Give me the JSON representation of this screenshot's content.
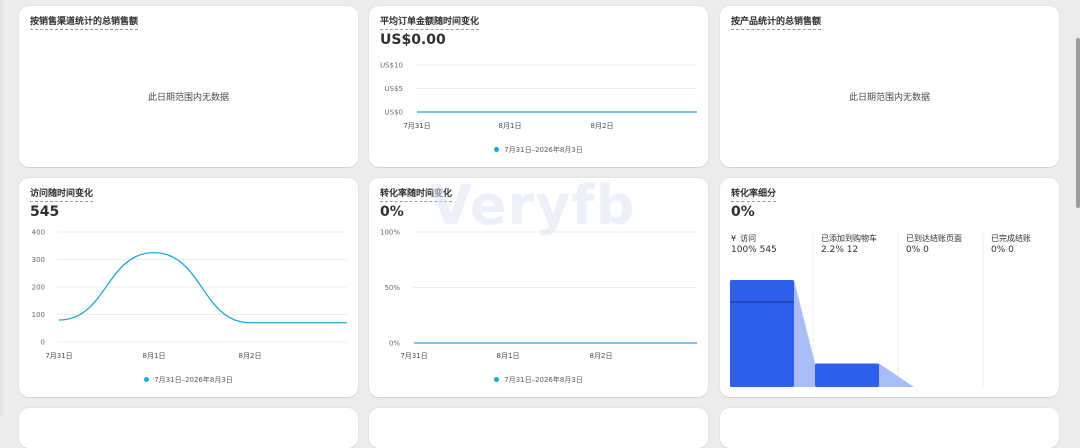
{
  "cards": {
    "sales_by_channel": {
      "title": "按销售渠道统计的总销售额",
      "empty": "此日期范围内无数据"
    },
    "aov": {
      "title": "平均订单金额随时间变化",
      "value": "US$0.00",
      "legend": "7月31日–2026年8月3日"
    },
    "sales_by_product": {
      "title": "按产品统计的总销售额",
      "empty": "此日期范围内无数据"
    },
    "sessions": {
      "title": "访问随时间变化",
      "value": "545",
      "legend": "7月31日–2026年8月3日"
    },
    "conversion": {
      "title": "转化率随时间变化",
      "value": "0%",
      "legend": "7月31日–2026年8月3日"
    },
    "funnel": {
      "title": "转化率细分",
      "value": "0%",
      "visits_icon": "¥",
      "steps": [
        {
          "label": "访问",
          "stat": "100% 545"
        },
        {
          "label": "已添加到购物车",
          "stat": "2.2% 12"
        },
        {
          "label": "已到达结账页面",
          "stat": "0% 0"
        },
        {
          "label": "已完成结账",
          "stat": "0% 0"
        }
      ]
    }
  },
  "watermark": "Veryfb",
  "chart_data": [
    {
      "type": "line",
      "categories": [
        "7月31日",
        "8月1日",
        "8月2日"
      ],
      "yticks": [
        "US$0",
        "US$5",
        "US$10"
      ],
      "ylim": [
        0,
        10
      ],
      "series": [
        {
          "name": "7月31日–2026年8月3日",
          "values": [
            0,
            0,
            0,
            0
          ]
        }
      ],
      "color": "#1ea7d6",
      "grid": true
    },
    {
      "type": "line",
      "categories": [
        "7月31日",
        "8月1日",
        "8月2日"
      ],
      "yticks": [
        "0",
        "100",
        "200",
        "300",
        "400"
      ],
      "ylim": [
        0,
        400
      ],
      "series": [
        {
          "name": "7月31日–2026年8月3日",
          "values": [
            80,
            325,
            70,
            70
          ]
        }
      ],
      "color": "#1ea7d6",
      "grid": true
    },
    {
      "type": "line",
      "categories": [
        "7月31日",
        "8月1日",
        "8月2日"
      ],
      "yticks": [
        "0%",
        "50%",
        "100%"
      ],
      "ylim": [
        0,
        100
      ],
      "series": [
        {
          "name": "7月31日–2026年8月3日",
          "values": [
            0,
            0,
            0,
            0
          ]
        }
      ],
      "color": "#1ea7d6",
      "grid": true
    },
    {
      "type": "bar",
      "categories": [
        "访问",
        "已添加到购物车",
        "已到达结账页面",
        "已完成结账"
      ],
      "values": [
        100,
        22,
        0,
        0
      ],
      "ylim": [
        0,
        100
      ],
      "color": "#2f5ee8"
    }
  ]
}
